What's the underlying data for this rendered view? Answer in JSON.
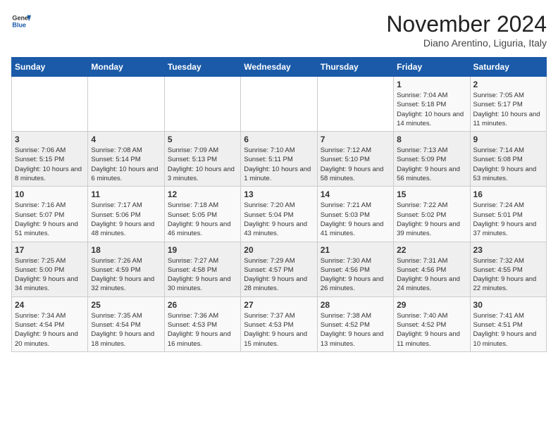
{
  "logo": {
    "general": "General",
    "blue": "Blue"
  },
  "header": {
    "month": "November 2024",
    "location": "Diano Arentino, Liguria, Italy"
  },
  "days_of_week": [
    "Sunday",
    "Monday",
    "Tuesday",
    "Wednesday",
    "Thursday",
    "Friday",
    "Saturday"
  ],
  "weeks": [
    [
      {
        "day": "",
        "info": ""
      },
      {
        "day": "",
        "info": ""
      },
      {
        "day": "",
        "info": ""
      },
      {
        "day": "",
        "info": ""
      },
      {
        "day": "",
        "info": ""
      },
      {
        "day": "1",
        "info": "Sunrise: 7:04 AM\nSunset: 5:18 PM\nDaylight: 10 hours and 14 minutes."
      },
      {
        "day": "2",
        "info": "Sunrise: 7:05 AM\nSunset: 5:17 PM\nDaylight: 10 hours and 11 minutes."
      }
    ],
    [
      {
        "day": "3",
        "info": "Sunrise: 7:06 AM\nSunset: 5:15 PM\nDaylight: 10 hours and 8 minutes."
      },
      {
        "day": "4",
        "info": "Sunrise: 7:08 AM\nSunset: 5:14 PM\nDaylight: 10 hours and 6 minutes."
      },
      {
        "day": "5",
        "info": "Sunrise: 7:09 AM\nSunset: 5:13 PM\nDaylight: 10 hours and 3 minutes."
      },
      {
        "day": "6",
        "info": "Sunrise: 7:10 AM\nSunset: 5:11 PM\nDaylight: 10 hours and 1 minute."
      },
      {
        "day": "7",
        "info": "Sunrise: 7:12 AM\nSunset: 5:10 PM\nDaylight: 9 hours and 58 minutes."
      },
      {
        "day": "8",
        "info": "Sunrise: 7:13 AM\nSunset: 5:09 PM\nDaylight: 9 hours and 56 minutes."
      },
      {
        "day": "9",
        "info": "Sunrise: 7:14 AM\nSunset: 5:08 PM\nDaylight: 9 hours and 53 minutes."
      }
    ],
    [
      {
        "day": "10",
        "info": "Sunrise: 7:16 AM\nSunset: 5:07 PM\nDaylight: 9 hours and 51 minutes."
      },
      {
        "day": "11",
        "info": "Sunrise: 7:17 AM\nSunset: 5:06 PM\nDaylight: 9 hours and 48 minutes."
      },
      {
        "day": "12",
        "info": "Sunrise: 7:18 AM\nSunset: 5:05 PM\nDaylight: 9 hours and 46 minutes."
      },
      {
        "day": "13",
        "info": "Sunrise: 7:20 AM\nSunset: 5:04 PM\nDaylight: 9 hours and 43 minutes."
      },
      {
        "day": "14",
        "info": "Sunrise: 7:21 AM\nSunset: 5:03 PM\nDaylight: 9 hours and 41 minutes."
      },
      {
        "day": "15",
        "info": "Sunrise: 7:22 AM\nSunset: 5:02 PM\nDaylight: 9 hours and 39 minutes."
      },
      {
        "day": "16",
        "info": "Sunrise: 7:24 AM\nSunset: 5:01 PM\nDaylight: 9 hours and 37 minutes."
      }
    ],
    [
      {
        "day": "17",
        "info": "Sunrise: 7:25 AM\nSunset: 5:00 PM\nDaylight: 9 hours and 34 minutes."
      },
      {
        "day": "18",
        "info": "Sunrise: 7:26 AM\nSunset: 4:59 PM\nDaylight: 9 hours and 32 minutes."
      },
      {
        "day": "19",
        "info": "Sunrise: 7:27 AM\nSunset: 4:58 PM\nDaylight: 9 hours and 30 minutes."
      },
      {
        "day": "20",
        "info": "Sunrise: 7:29 AM\nSunset: 4:57 PM\nDaylight: 9 hours and 28 minutes."
      },
      {
        "day": "21",
        "info": "Sunrise: 7:30 AM\nSunset: 4:56 PM\nDaylight: 9 hours and 26 minutes."
      },
      {
        "day": "22",
        "info": "Sunrise: 7:31 AM\nSunset: 4:56 PM\nDaylight: 9 hours and 24 minutes."
      },
      {
        "day": "23",
        "info": "Sunrise: 7:32 AM\nSunset: 4:55 PM\nDaylight: 9 hours and 22 minutes."
      }
    ],
    [
      {
        "day": "24",
        "info": "Sunrise: 7:34 AM\nSunset: 4:54 PM\nDaylight: 9 hours and 20 minutes."
      },
      {
        "day": "25",
        "info": "Sunrise: 7:35 AM\nSunset: 4:54 PM\nDaylight: 9 hours and 18 minutes."
      },
      {
        "day": "26",
        "info": "Sunrise: 7:36 AM\nSunset: 4:53 PM\nDaylight: 9 hours and 16 minutes."
      },
      {
        "day": "27",
        "info": "Sunrise: 7:37 AM\nSunset: 4:53 PM\nDaylight: 9 hours and 15 minutes."
      },
      {
        "day": "28",
        "info": "Sunrise: 7:38 AM\nSunset: 4:52 PM\nDaylight: 9 hours and 13 minutes."
      },
      {
        "day": "29",
        "info": "Sunrise: 7:40 AM\nSunset: 4:52 PM\nDaylight: 9 hours and 11 minutes."
      },
      {
        "day": "30",
        "info": "Sunrise: 7:41 AM\nSunset: 4:51 PM\nDaylight: 9 hours and 10 minutes."
      }
    ]
  ]
}
